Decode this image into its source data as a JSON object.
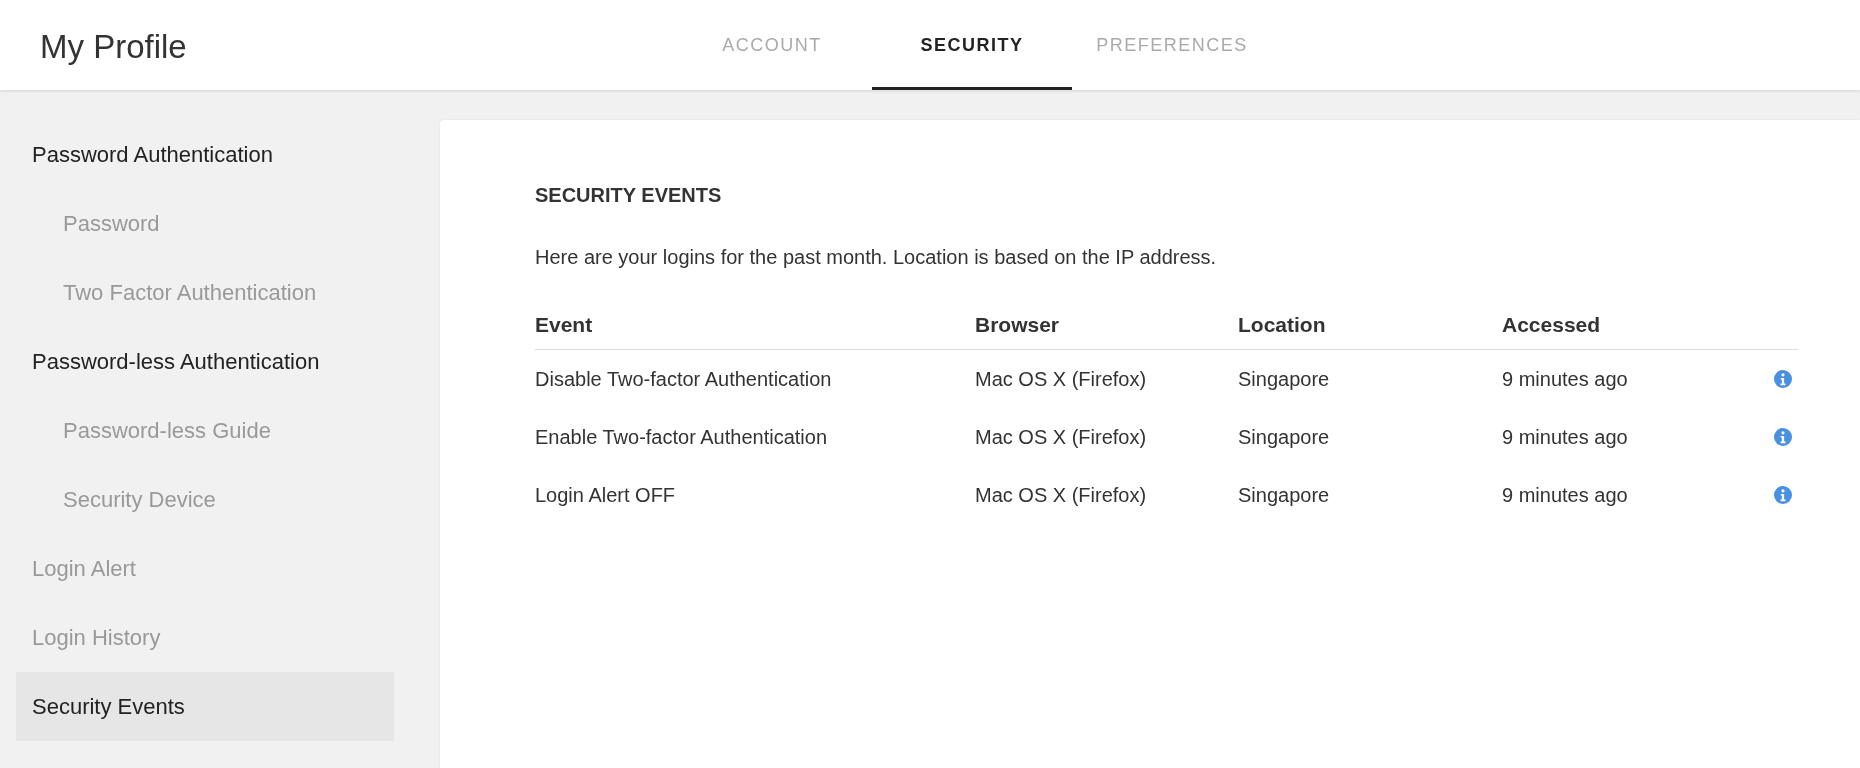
{
  "header": {
    "title": "My Profile"
  },
  "tabs": [
    {
      "label": "ACCOUNT",
      "selected": false
    },
    {
      "label": "SECURITY",
      "selected": true
    },
    {
      "label": "PREFERENCES",
      "selected": false
    }
  ],
  "sidebar": {
    "items": [
      {
        "label": "Password Authentication",
        "children": [
          {
            "label": "Password",
            "selected": false
          },
          {
            "label": "Two Factor Authentication",
            "selected": false
          }
        ]
      },
      {
        "label": "Password-less Authentication",
        "children": [
          {
            "label": "Password-less Guide",
            "selected": false
          },
          {
            "label": "Security Device",
            "selected": false
          }
        ]
      },
      {
        "label": "Login Alert",
        "selected": false
      },
      {
        "label": "Login History",
        "selected": false
      },
      {
        "label": "Security Events",
        "selected": true
      }
    ]
  },
  "panel": {
    "heading": "SECURITY EVENTS",
    "description": "Here are your logins for the past month. Location is based on the IP address.",
    "table": {
      "columns": [
        "Event",
        "Browser",
        "Location",
        "Accessed"
      ],
      "rows": [
        {
          "cells": [
            "Disable Two-factor Authentication",
            "Mac OS X (Firefox)",
            "Singapore",
            "9 minutes ago"
          ]
        },
        {
          "cells": [
            "Enable Two-factor Authentication",
            "Mac OS X (Firefox)",
            "Singapore",
            "9 minutes ago"
          ]
        },
        {
          "cells": [
            "Login Alert OFF",
            "Mac OS X (Firefox)",
            "Singapore",
            "9 minutes ago"
          ]
        }
      ]
    }
  }
}
